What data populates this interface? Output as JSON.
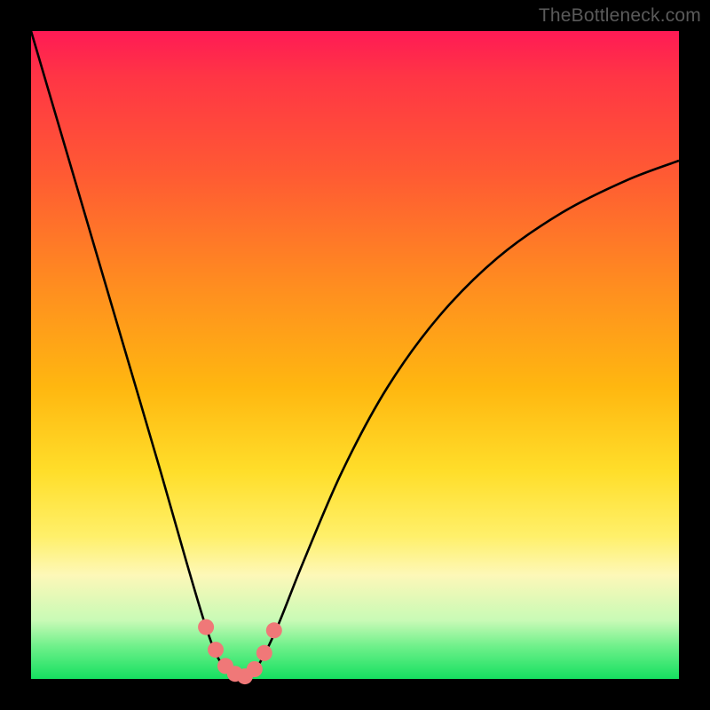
{
  "watermark": "TheBottleneck.com",
  "chart_data": {
    "type": "line",
    "title": "",
    "xlabel": "",
    "ylabel": "",
    "xlim": [
      0,
      100
    ],
    "ylim": [
      0,
      100
    ],
    "series": [
      {
        "name": "bottleneck-curve",
        "x": [
          0,
          5,
          10,
          15,
          20,
          24,
          27,
          29,
          31,
          33,
          35,
          38,
          42,
          48,
          55,
          63,
          72,
          82,
          92,
          100
        ],
        "y": [
          100,
          83,
          66,
          49,
          32,
          18,
          8,
          3,
          1,
          0,
          2,
          8,
          18,
          32,
          45,
          56,
          65,
          72,
          77,
          80
        ]
      }
    ],
    "markers": {
      "name": "highlight-points",
      "color": "#f07878",
      "points": [
        {
          "x": 27.0,
          "y": 8.0
        },
        {
          "x": 28.5,
          "y": 4.5
        },
        {
          "x": 30.0,
          "y": 2.0
        },
        {
          "x": 31.5,
          "y": 0.8
        },
        {
          "x": 33.0,
          "y": 0.4
        },
        {
          "x": 34.5,
          "y": 1.5
        },
        {
          "x": 36.0,
          "y": 4.0
        },
        {
          "x": 37.5,
          "y": 7.5
        }
      ]
    },
    "gradient_stops": [
      {
        "pos": 0,
        "color": "#ff1a55"
      },
      {
        "pos": 50,
        "color": "#ffb710"
      },
      {
        "pos": 80,
        "color": "#fff06a"
      },
      {
        "pos": 100,
        "color": "#15e060"
      }
    ]
  }
}
